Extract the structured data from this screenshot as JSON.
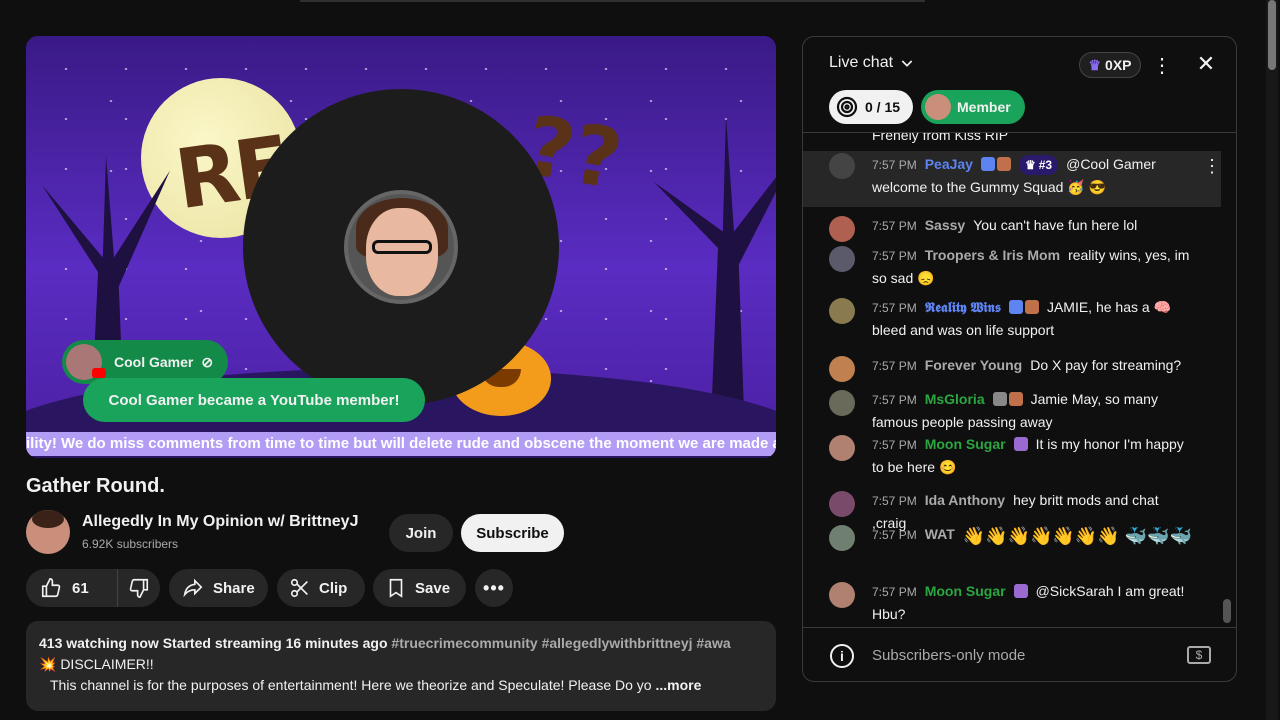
{
  "video": {
    "ticker": "ility! We do miss comments from time to time but will delete rude and obscene the moment we are made aw",
    "overlay_text_left": "RE",
    "overlay_text_right": "??",
    "notif_name": "Cool Gamer",
    "notif_text": "Cool Gamer became a YouTube member!"
  },
  "title": "Gather Round.",
  "channel": {
    "name": "Allegedly In My Opinion w/ BrittneyJ",
    "subscribers": "6.92K subscribers",
    "join_label": "Join",
    "subscribe_label": "Subscribe"
  },
  "actions": {
    "likes": "61",
    "share_label": "Share",
    "clip_label": "Clip",
    "save_label": "Save",
    "more_icon": "more-horiz-icon"
  },
  "description": {
    "stats": "413 watching now  Started streaming 16 minutes ago",
    "tags": "#truecrimecommunity #allegedlywithbrittneyj #awa",
    "line2": "💥 DISCLAIMER!!",
    "line3": "This channel is for the purposes of entertainment!  Here we theorize and Speculate!  Please Do yo",
    "more_label": "...more"
  },
  "chat": {
    "title": "Live chat",
    "xp": "0XP",
    "goal": "0 / 15",
    "member_label": "Member",
    "partial_top": "Frenely from Kiss RIP",
    "messages": [
      {
        "time": "7:57 PM",
        "author": "PeaJay",
        "rank": "#3",
        "text": "@Cool Gamer welcome to the Gummy Squad 🥳 😎",
        "style": "blue",
        "avatar": "#444444"
      },
      {
        "time": "7:57 PM",
        "author": "Sassy",
        "text": "You can't have fun here lol",
        "style": "",
        "avatar": "#b06050"
      },
      {
        "time": "7:57 PM",
        "author": "Troopers & Iris Mom",
        "text": "reality wins, yes, im so sad 😞",
        "style": "",
        "avatar": "#5a5a6a"
      },
      {
        "time": "7:57 PM",
        "author": "𝕽𝖊𝖆𝖑𝖎𝖙𝖞 𝖂𝖎𝖓𝖘",
        "text": "JAMIE, he has a 🧠 bleed and was on life support",
        "style": "blue",
        "avatar": "#8a7a50"
      },
      {
        "time": "7:57 PM",
        "author": "Forever Young",
        "text": "Do X pay for streaming?",
        "style": "",
        "avatar": "#c08050"
      },
      {
        "time": "7:57 PM",
        "author": "MsGloria",
        "text": "Jamie May, so many famous people passing away",
        "style": "green",
        "avatar": "#6a6a5a"
      },
      {
        "time": "7:57 PM",
        "author": "Moon Sugar",
        "text": "It is my honor I'm happy to be here 😊",
        "style": "green",
        "avatar": "#b08070"
      },
      {
        "time": "7:57 PM",
        "author": "Ida Anthony",
        "text": "hey britt mods and chat ,craig",
        "style": "",
        "avatar": "#7a4a6a"
      },
      {
        "time": "7:57 PM",
        "author": "WAT",
        "text": "👋👋👋👋👋👋👋 🐳🐳🐳",
        "style": "",
        "avatar": "#708070"
      },
      {
        "time": "7:57 PM",
        "author": "Moon Sugar",
        "text": "@SickSarah I am great! Hbu?",
        "style": "green",
        "avatar": "#b08070"
      }
    ],
    "footer": "Subscribers-only mode"
  }
}
